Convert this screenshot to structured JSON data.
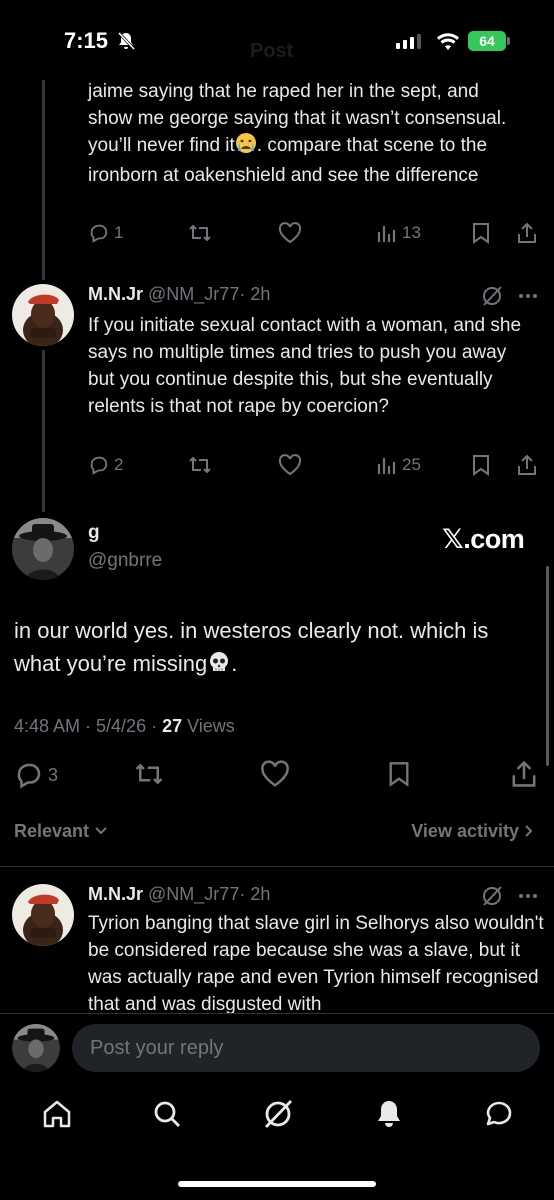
{
  "status": {
    "time": "7:15",
    "battery": "64"
  },
  "header": {
    "ghost_title": "Post"
  },
  "prev_reply": {
    "text": "jaime saying that he raped her in the sept, and show me george saying that it wasn’t consensual. you’ll never find it",
    "text_after": ". compare that scene to the ironborn at oakenshield and see the difference",
    "emoji": "crying-face",
    "replies": "1",
    "views": "13"
  },
  "reply_1": {
    "name": "M.N.Jr",
    "handle": "@NM_Jr77",
    "time": "· 2h",
    "text": "If you initiate sexual contact with a woman, and she says no multiple times and tries to push you away but you continue despite this, but she eventually relents is that not rape by coercion?",
    "replies": "2",
    "views": "25"
  },
  "main_post": {
    "name": "g",
    "handle": "@gnbrre",
    "watermark": "𝕏.com",
    "text": "in our world yes. in westeros clearly not. which is what you’re missing",
    "text_after": ".",
    "emoji": "skull",
    "timestamp": "4:48 AM · 5/4/26 · ",
    "views_count": "27",
    "views_label": " Views",
    "replies": "3"
  },
  "sort": {
    "left": "Relevant",
    "right": "View activity"
  },
  "reply_2": {
    "name": "M.N.Jr",
    "handle": "@NM_Jr77",
    "time": "· 2h",
    "text": "Tyrion banging that slave girl in Selhorys also wouldn't be considered rape because she was a slave, but it was actually rape and even Tyrion himself recognised that and was disgusted with"
  },
  "compose": {
    "placeholder": "Post your reply"
  },
  "colors": {
    "background": "#000000",
    "text": "#e7e9ea",
    "muted": "#71767b",
    "battery": "#34c759"
  }
}
